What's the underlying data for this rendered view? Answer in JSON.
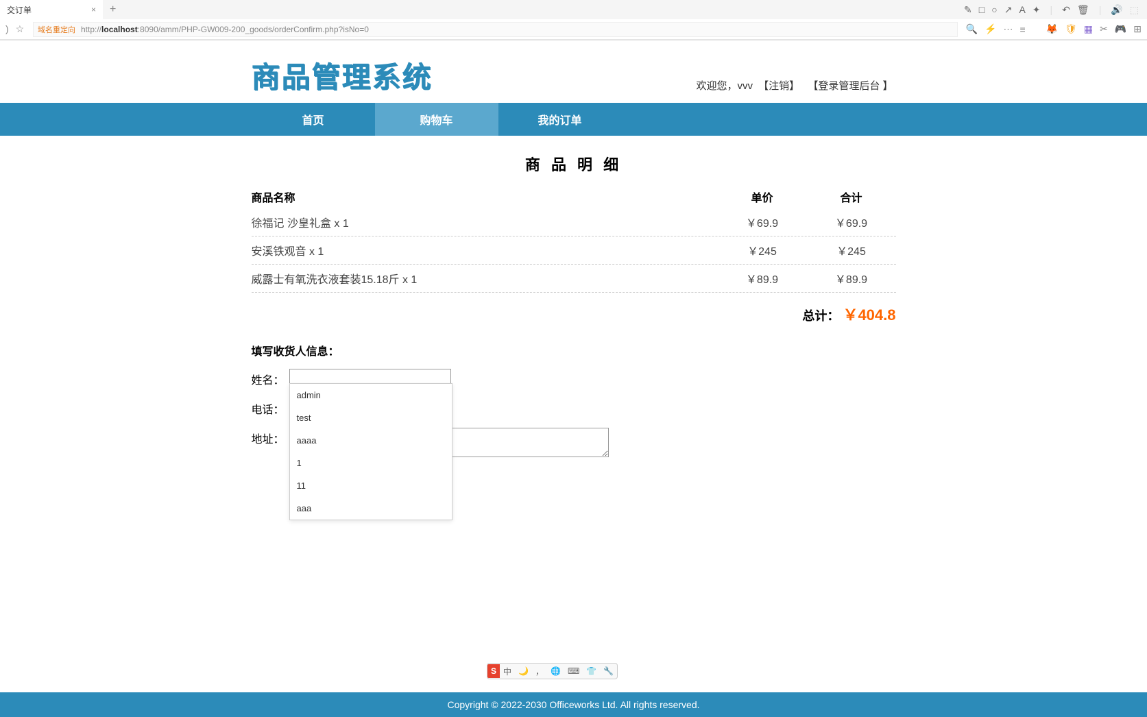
{
  "browser": {
    "tab_title": "交订单",
    "redirect_label": "域名重定向",
    "url_prefix": "http://",
    "url_host": "localhost",
    "url_rest": ":8090/amm/PHP-GW009-200_goods/orderConfirm.php?isNo=0"
  },
  "header": {
    "logo": "商品管理系统",
    "welcome": "欢迎您，vvv",
    "logout": "【注销】",
    "admin": "【登录管理后台 】"
  },
  "nav": {
    "home": "首页",
    "cart": "购物车",
    "orders": "我的订单"
  },
  "section_title": "商 品 明 细",
  "table": {
    "headers": {
      "name": "商品名称",
      "price": "单价",
      "total": "合计"
    },
    "rows": [
      {
        "name": "徐福记 沙皇礼盒 x 1",
        "price": "￥69.9",
        "total": "￥69.9"
      },
      {
        "name": "安溪铁观音 x 1",
        "price": "￥245",
        "total": "￥245"
      },
      {
        "name": "威露士有氧洗衣液套装15.18斤 x 1",
        "price": "￥89.9",
        "total": "￥89.9"
      }
    ],
    "total_label": "总计：",
    "total_amount": "￥404.8"
  },
  "form": {
    "title": "填写收货人信息：",
    "name_label": "姓名：",
    "phone_label": "电话：",
    "address_label": "地址：",
    "name_value": "",
    "phone_value": "",
    "address_value": ""
  },
  "autocomplete": {
    "items": [
      "admin",
      "test",
      "aaaa",
      "1",
      "11",
      "aaa"
    ]
  },
  "ime": {
    "logo": "S",
    "items": [
      "中",
      "🌙",
      "，",
      "🌐",
      "⌨",
      "👕",
      "🔧"
    ]
  },
  "footer": "Copyright © 2022-2030 Officeworks Ltd. All rights reserved."
}
